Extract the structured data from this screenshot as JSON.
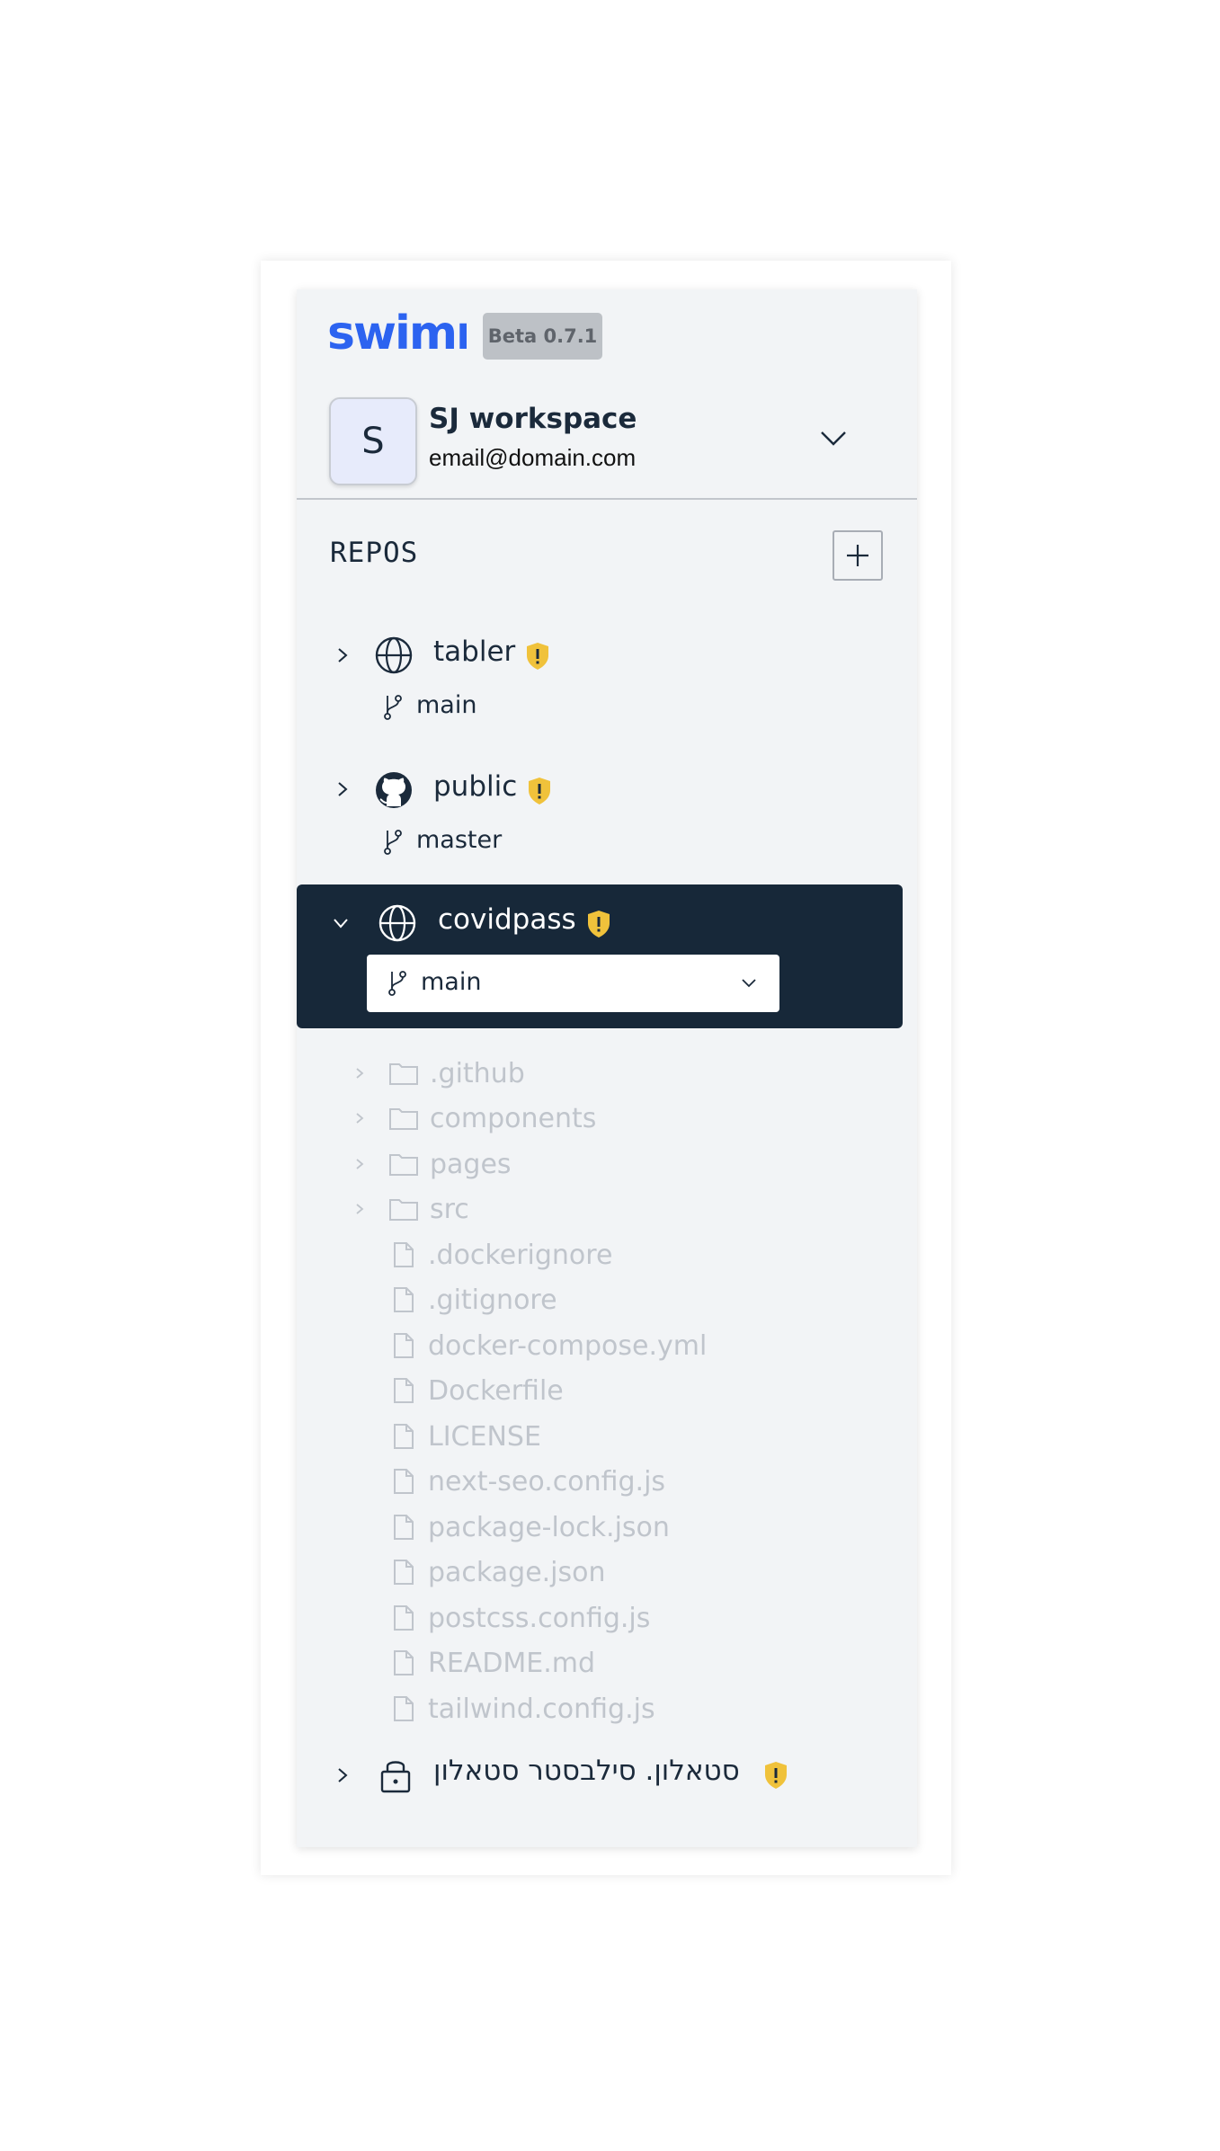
{
  "app": {
    "logo_text": "swimm",
    "version_badge": "Beta 0.7.1"
  },
  "workspace": {
    "avatar_letter": "S",
    "name": "SJ workspace",
    "email": "email@domain.com"
  },
  "repos_section": {
    "title": "REPOS",
    "add_icon": "plus-icon"
  },
  "repos": [
    {
      "name": "tabler",
      "icon": "globe-icon",
      "branch": "main",
      "expanded": false
    },
    {
      "name": "public",
      "icon": "github-icon",
      "branch": "master",
      "expanded": false
    },
    {
      "name": "covidpass",
      "icon": "globe-icon",
      "branch": "main",
      "expanded": true
    },
    {
      "name": "סטאלון. סילבסטר סטאלון",
      "icon": "lock-icon",
      "expanded": false
    }
  ],
  "file_tree": [
    {
      "name": ".github",
      "type": "folder"
    },
    {
      "name": "components",
      "type": "folder"
    },
    {
      "name": "pages",
      "type": "folder"
    },
    {
      "name": "src",
      "type": "folder"
    },
    {
      "name": ".dockerignore",
      "type": "file"
    },
    {
      "name": ".gitignore",
      "type": "file"
    },
    {
      "name": "docker-compose.yml",
      "type": "file"
    },
    {
      "name": "Dockerfile",
      "type": "file"
    },
    {
      "name": "LICENSE",
      "type": "file"
    },
    {
      "name": "next-seo.config.js",
      "type": "file"
    },
    {
      "name": "package-lock.json",
      "type": "file"
    },
    {
      "name": "package.json",
      "type": "file"
    },
    {
      "name": "postcss.config.js",
      "type": "file"
    },
    {
      "name": "README.md",
      "type": "file"
    },
    {
      "name": "tailwind.config.js",
      "type": "file"
    }
  ],
  "colors": {
    "brand_blue": "#2c63f0",
    "active_bg": "#172839",
    "shield_yellow": "#f0c23b",
    "panel_bg": "#f2f4f6",
    "muted_text": "#c0c5cc"
  }
}
